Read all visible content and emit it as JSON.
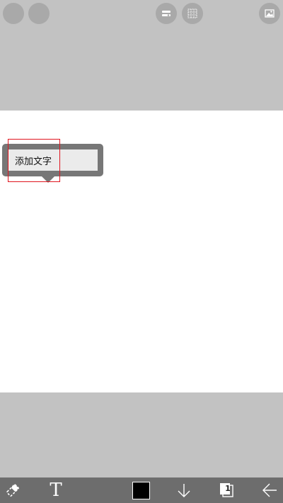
{
  "popup": {
    "label": "添加文字"
  },
  "toolbar": {
    "text_tool_glyph": "T",
    "page_count": "1",
    "current_color": "#000000"
  },
  "icons": {
    "top_left_1": "circle-icon",
    "top_left_2": "circle-icon",
    "top_center_1": "layers-toggle-icon",
    "top_center_2": "grid-icon",
    "top_right": "image-icon",
    "eraser": "eraser-icon",
    "download": "arrow-down-icon",
    "pages": "pages-icon",
    "back": "arrow-left-icon"
  },
  "colors": {
    "background": "#c2c2c2",
    "canvas": "#ffffff",
    "toolbar": "#6d6d6d",
    "highlight": "#e0151f"
  }
}
